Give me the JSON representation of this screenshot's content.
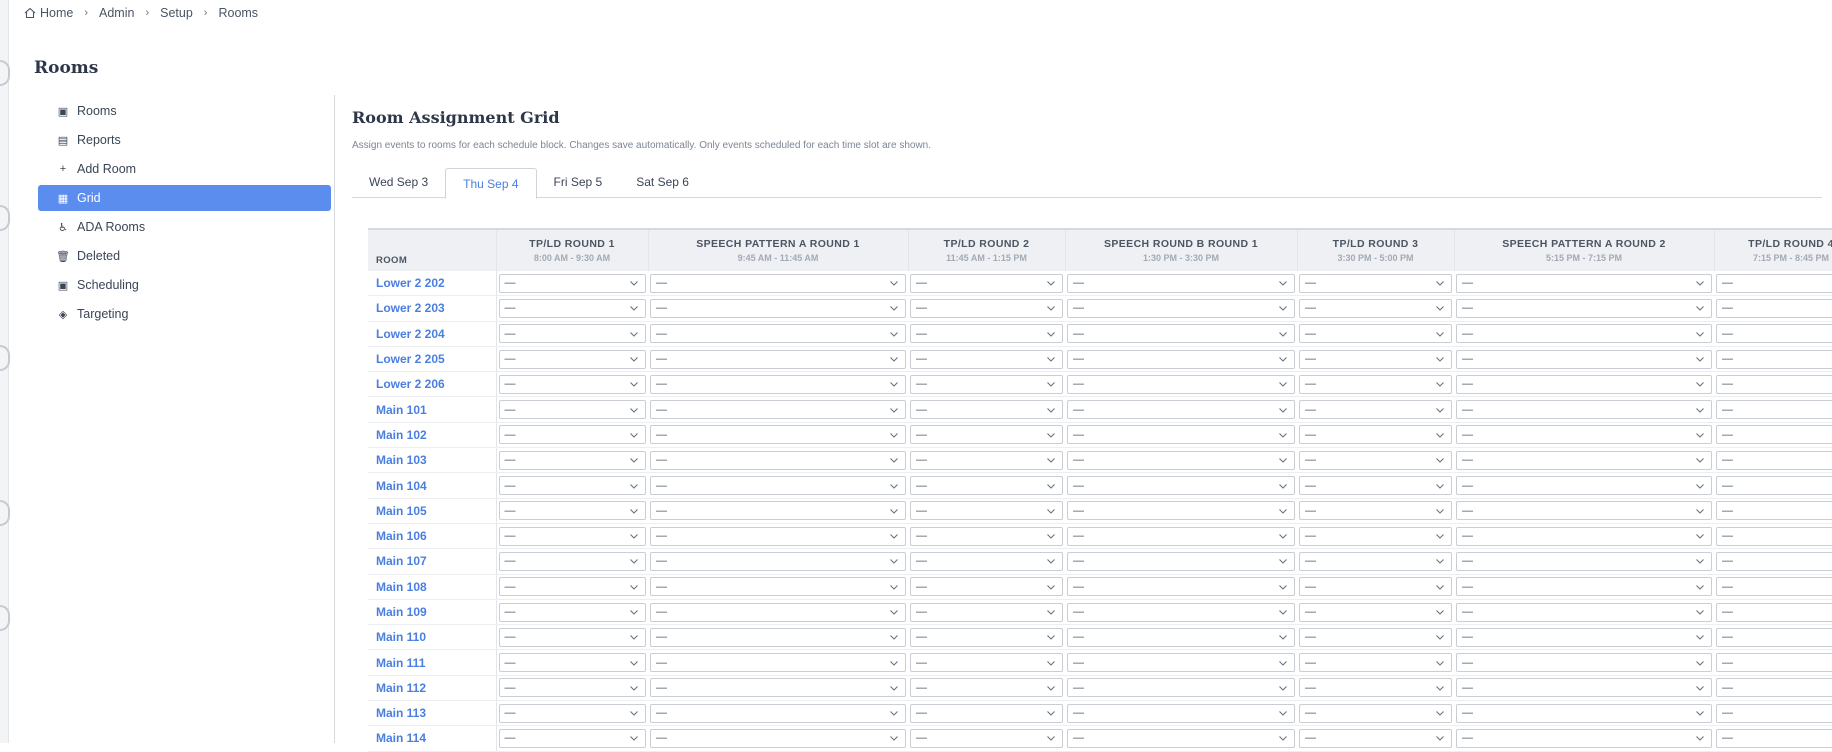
{
  "breadcrumb": [
    {
      "label": "Home",
      "icon": "home-icon"
    },
    {
      "label": "Admin"
    },
    {
      "label": "Setup"
    },
    {
      "label": "Rooms"
    }
  ],
  "page_title": "Rooms",
  "sidebar": {
    "items": [
      {
        "label": "Rooms",
        "icon": "room-icon",
        "glyph": "▣"
      },
      {
        "label": "Reports",
        "icon": "report-icon",
        "glyph": "▤"
      },
      {
        "label": "Add Room",
        "icon": "plus-icon",
        "glyph": "+"
      },
      {
        "label": "Grid",
        "icon": "grid-icon",
        "glyph": "▦",
        "active": true
      },
      {
        "label": "ADA Rooms",
        "icon": "wheelchair-icon",
        "glyph": "♿"
      },
      {
        "label": "Deleted",
        "icon": "trash-icon",
        "glyph": "🗑"
      },
      {
        "label": "Scheduling",
        "icon": "calendar-icon",
        "glyph": "▣"
      },
      {
        "label": "Targeting",
        "icon": "target-icon",
        "glyph": "◈"
      }
    ]
  },
  "main": {
    "title": "Room Assignment Grid",
    "subtitle": "Assign events to rooms for each schedule block. Changes save automatically. Only events scheduled for each time slot are shown.",
    "tabs": [
      {
        "label": "Wed Sep 3"
      },
      {
        "label": "Thu Sep 4",
        "active": true
      },
      {
        "label": "Fri Sep 5"
      },
      {
        "label": "Sat Sep 6"
      }
    ]
  },
  "grid": {
    "room_header": "ROOM",
    "columns": [
      {
        "name": "TP/LD ROUND 1",
        "time": "8:00 AM - 9:30 AM"
      },
      {
        "name": "SPEECH PATTERN A ROUND 1",
        "time": "9:45 AM - 11:45 AM"
      },
      {
        "name": "TP/LD ROUND 2",
        "time": "11:45 AM - 1:15 PM"
      },
      {
        "name": "SPEECH ROUND B ROUND 1",
        "time": "1:30 PM - 3:30 PM"
      },
      {
        "name": "TP/LD ROUND 3",
        "time": "3:30 PM - 5:00 PM"
      },
      {
        "name": "SPEECH PATTERN A ROUND 2",
        "time": "5:15 PM - 7:15 PM"
      },
      {
        "name": "TP/LD ROUND 4",
        "time": "7:15 PM - 8:45 PM"
      }
    ],
    "select_value": "—",
    "rooms": [
      "Lower 2 202",
      "Lower 2 203",
      "Lower 2 204",
      "Lower 2 205",
      "Lower 2 206",
      "Main 101",
      "Main 102",
      "Main 103",
      "Main 104",
      "Main 105",
      "Main 106",
      "Main 107",
      "Main 108",
      "Main 109",
      "Main 110",
      "Main 111",
      "Main 112",
      "Main 113",
      "Main 114"
    ]
  },
  "colors": {
    "accent": "#5b8def",
    "link": "#4a7fe0"
  }
}
